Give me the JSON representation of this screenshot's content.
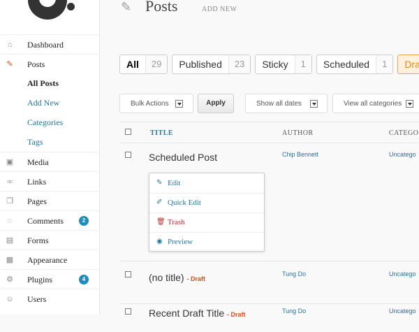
{
  "sidebar": {
    "items": [
      {
        "label": "Dashboard",
        "icon": "house-icon"
      },
      {
        "label": "Posts",
        "icon": "pushpin-icon"
      },
      {
        "label": "All Posts"
      },
      {
        "label": "Add New"
      },
      {
        "label": "Categories"
      },
      {
        "label": "Tags"
      },
      {
        "label": "Media",
        "icon": "media-icon"
      },
      {
        "label": "Links",
        "icon": "link-icon"
      },
      {
        "label": "Pages",
        "icon": "pages-icon"
      },
      {
        "label": "Comments",
        "icon": "comment-icon",
        "badge": "2"
      },
      {
        "label": "Forms",
        "icon": "forms-icon"
      },
      {
        "label": "Appearance",
        "icon": "appearance-icon"
      },
      {
        "label": "Plugins",
        "icon": "plugin-icon",
        "badge": "4"
      },
      {
        "label": "Users",
        "icon": "users-icon"
      }
    ]
  },
  "header": {
    "title": "Posts",
    "add_new": "ADD NEW"
  },
  "tabs": [
    {
      "label": "All",
      "count": "29"
    },
    {
      "label": "Published",
      "count": "23"
    },
    {
      "label": "Sticky",
      "count": "1"
    },
    {
      "label": "Scheduled",
      "count": "1"
    },
    {
      "label": "Dra"
    }
  ],
  "filters": {
    "bulk_actions": "Bulk Actions",
    "apply": "Apply",
    "dates": "Show all dates",
    "categories": "View all categories"
  },
  "table": {
    "columns": {
      "title": "TITLE",
      "author": "AUTHOR",
      "categories": "CATEGO"
    },
    "rows": [
      {
        "title": "Scheduled Post",
        "draft": "",
        "author": "Chip Bennett",
        "category": "Uncatego"
      },
      {
        "title": "(no title)",
        "draft": "- Draft",
        "author": "Tung Do",
        "category": "Uncatego"
      },
      {
        "title": "Recent Draft Title",
        "draft": "- Draft",
        "author": "Tung Do",
        "category": "Uncatego"
      }
    ]
  },
  "row_actions": {
    "edit": "Edit",
    "quick_edit": "Quick Edit",
    "trash": "Trash",
    "preview": "Preview"
  },
  "colors": {
    "link": "#21759b",
    "badge": "#1e8cbe",
    "draft": "#d54e21",
    "trash": "#b32d2e",
    "highlight_tab": "#e08a1e"
  }
}
